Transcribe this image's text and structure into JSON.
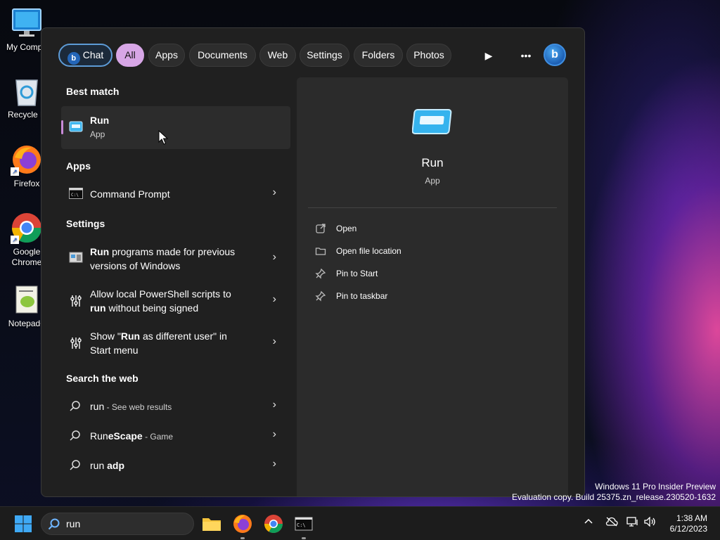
{
  "desktop": {
    "icons": [
      {
        "label": "My Compu",
        "name": "my-computer"
      },
      {
        "label": "Recycle B",
        "name": "recycle-bin"
      },
      {
        "label": "Firefox",
        "name": "firefox"
      },
      {
        "label": "Google",
        "label2": "Chrome",
        "name": "google-chrome"
      },
      {
        "label": "Notepad+",
        "name": "notepad-plus-plus"
      }
    ]
  },
  "search_panel": {
    "filters": {
      "chat": "Chat",
      "all": "All",
      "apps": "Apps",
      "documents": "Documents",
      "web": "Web",
      "settings": "Settings",
      "folders": "Folders",
      "photos": "Photos"
    },
    "toolbar_icons": [
      "play-icon",
      "more-icon",
      "bing-icon"
    ],
    "sections": {
      "best_match": "Best match",
      "apps": "Apps",
      "settings": "Settings",
      "search_web": "Search the web"
    },
    "best_match": {
      "title": "Run",
      "subtitle": "App"
    },
    "apps": [
      {
        "label": "Command Prompt",
        "icon": "cmd-icon"
      }
    ],
    "settings": [
      {
        "bold": "Run",
        "rest": " programs made for previous versions of Windows",
        "icon": "compat-icon"
      },
      {
        "pre": "Allow local PowerShell scripts to ",
        "bold": "run",
        "rest": " without being signed",
        "icon": "dev-settings-icon"
      },
      {
        "pre": "Show \"",
        "bold": "Run",
        "rest": " as different user\" in Start menu",
        "icon": "dev-settings-icon"
      }
    ],
    "web": [
      {
        "main": "run",
        "sep": " - ",
        "sub": "See web results"
      },
      {
        "main": "Run",
        "bold": "eScape",
        "sep": " - ",
        "sub": "Game"
      },
      {
        "main": "run ",
        "bold": "adp",
        "sep": "",
        "sub": ""
      }
    ],
    "detail": {
      "title": "Run",
      "subtitle": "App",
      "actions": [
        {
          "label": "Open",
          "icon": "open-external-icon"
        },
        {
          "label": "Open file location",
          "icon": "folder-icon"
        },
        {
          "label": "Pin to Start",
          "icon": "pin-icon"
        },
        {
          "label": "Pin to taskbar",
          "icon": "pin-icon"
        }
      ]
    }
  },
  "watermark": {
    "line1": "Windows 11 Pro Insider Preview",
    "line2": "Evaluation copy. Build 25375.zn_release.230520-1632"
  },
  "taskbar": {
    "search_query": "run",
    "apps": [
      "file-explorer",
      "firefox",
      "google-chrome",
      "command-prompt"
    ],
    "clock": {
      "time": "1:38 AM",
      "date": "6/12/2023"
    }
  }
}
